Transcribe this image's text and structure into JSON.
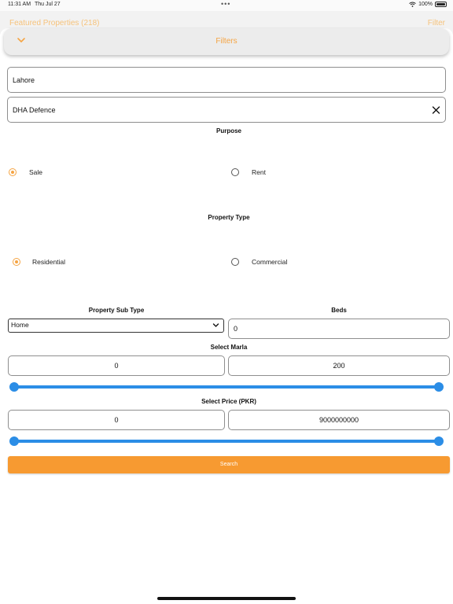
{
  "status_bar": {
    "time": "11:31 AM",
    "date": "Thu Jul 27",
    "battery": "100%"
  },
  "background_bar": {
    "title": "Featured Properties (218)",
    "action": "Filter"
  },
  "header": {
    "title": "Filters"
  },
  "city": {
    "value": "Lahore"
  },
  "area": {
    "value": "DHA Defence"
  },
  "purpose": {
    "label": "Purpose",
    "options": [
      {
        "label": "Sale",
        "selected": true
      },
      {
        "label": "Rent",
        "selected": false
      }
    ]
  },
  "property_type": {
    "label": "Property Type",
    "options": [
      {
        "label": "Residential",
        "selected": true
      },
      {
        "label": "Commercial",
        "selected": false
      }
    ]
  },
  "property_sub_type": {
    "label": "Property Sub Type",
    "value": "Home"
  },
  "beds": {
    "label": "Beds",
    "value": "0"
  },
  "marla": {
    "label": "Select Marla",
    "min": "0",
    "max": "200",
    "range_min_fraction": 0,
    "range_max_fraction": 1
  },
  "price": {
    "label": "Select Price (PKR)",
    "min": "0",
    "max": "9000000000",
    "range_min_fraction": 0,
    "range_max_fraction": 1
  },
  "search": {
    "label": "Search"
  },
  "colors": {
    "accent": "#f5a443",
    "button": "#f79a31",
    "slider": "#2b8de6"
  }
}
